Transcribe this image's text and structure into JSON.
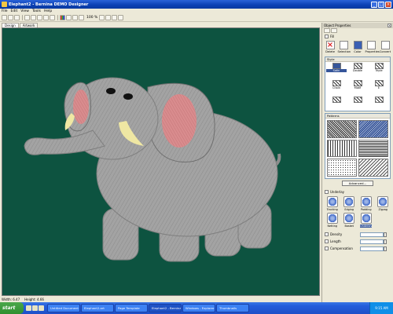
{
  "window": {
    "title": "Elephant2 - Bernina DEMO Designer"
  },
  "menu": [
    "File",
    "Edit",
    "View",
    "Tools",
    "Help"
  ],
  "toolbar": {
    "zoom_readout": "100 %"
  },
  "tabs": [
    "Design",
    "Artwork"
  ],
  "statusbar": {
    "left": "Width: 6.47",
    "right": "Height: 4.66"
  },
  "panel": {
    "title": "Object Properties",
    "fill_check": "Fill",
    "tools": [
      "Delete",
      "Selection",
      "Color",
      "Properties",
      "Convert"
    ],
    "style_header": "Style",
    "styles": [
      "Satin",
      "Double",
      "Triple",
      "Chain",
      "Motif",
      "E",
      "",
      "",
      "",
      "",
      "",
      ""
    ],
    "pattern_header": "Patterns",
    "advanced_label": "Advanced...",
    "underlay_label": "Underlay",
    "underlay": [
      "Tracking",
      "Edging",
      "Padding",
      "Zigzag",
      "Netting",
      "Basket",
      "Underlay",
      ""
    ],
    "params": [
      {
        "label": "Density",
        "value": ""
      },
      {
        "label": "Length",
        "value": ""
      },
      {
        "label": "Compensation",
        "value": ""
      }
    ]
  },
  "taskbar": {
    "start_label": "start",
    "buttons": [
      "Untitled Document",
      "Elephant2.art",
      "Page Template",
      "Elephant2 - Bernina",
      "Windows - Explorer",
      "Thumbnails"
    ],
    "clock": "9:15 AM"
  },
  "colors": {
    "canvas_bg": "#0d5340",
    "elephant_body": "#a3a3a3",
    "elephant_shadow": "#7f7f7f",
    "ear_inner": "#d98c8e",
    "tusk": "#efe7a3"
  }
}
